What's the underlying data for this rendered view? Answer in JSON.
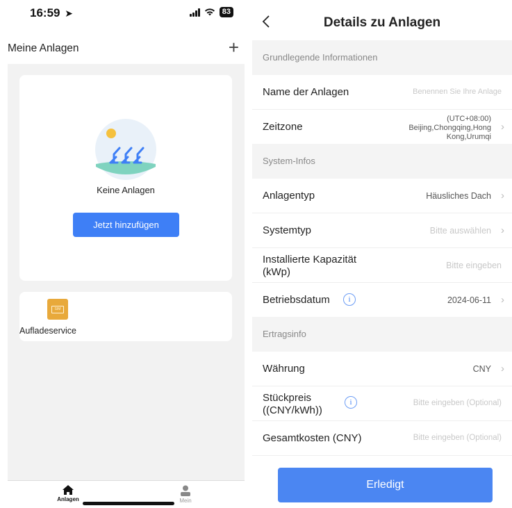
{
  "left_screen": {
    "status": {
      "time": "16:59",
      "battery": "83"
    },
    "header": {
      "title": "Meine Anlagen",
      "add_icon": "plus-icon"
    },
    "empty_state": {
      "text": "Keine Anlagen",
      "button": "Jetzt hinzufügen"
    },
    "service": {
      "label": "Aufladeservice",
      "icon": "sim-card-icon",
      "icon_text": "SIM"
    },
    "tabbar": {
      "tabs": [
        {
          "label": "Anlagen",
          "icon": "home-icon",
          "active": true
        },
        {
          "label": "Mein",
          "icon": "person-icon",
          "active": false
        }
      ]
    },
    "colors": {
      "primary": "#3e7ff6",
      "service_icon": "#e8a93b",
      "background": "#f2f2f2"
    }
  },
  "right_screen": {
    "nav": {
      "back_icon": "chevron-left-icon",
      "title": "Details zu Anlagen"
    },
    "sections": [
      {
        "title": "Grundlegende Informationen",
        "rows": [
          {
            "label": "Name der Anlagen",
            "value": "Benennen Sie Ihre Anlage",
            "placeholder": true,
            "chevron": false
          },
          {
            "label": "Zeitzone",
            "value": "(UTC+08:00) Beijing,Chongqing,Hong Kong,Urumqi",
            "placeholder": false,
            "chevron": true
          }
        ]
      },
      {
        "title": "System-Infos",
        "rows": [
          {
            "label": "Anlagentyp",
            "value": "Häusliches Dach",
            "placeholder": false,
            "chevron": true
          },
          {
            "label": "Systemtyp",
            "value": "Bitte auswählen",
            "placeholder": true,
            "chevron": true
          },
          {
            "label": "Installierte Kapazität (kWp)",
            "value": "Bitte eingeben",
            "placeholder": true,
            "chevron": false
          },
          {
            "label": "Betriebsdatum",
            "value": "2024-06-11",
            "placeholder": false,
            "chevron": true,
            "info": true
          }
        ]
      },
      {
        "title": "Ertragsinfo",
        "rows": [
          {
            "label": "Währung",
            "value": "CNY",
            "placeholder": false,
            "chevron": true
          },
          {
            "label": "Stückpreis ((CNY/kWh))",
            "value": "Bitte eingeben (Optional)",
            "placeholder": true,
            "chevron": false,
            "info": true
          },
          {
            "label": "Gesamtkosten (CNY)",
            "value": "Bitte eingeben (Optional)",
            "placeholder": true,
            "chevron": false
          }
        ]
      }
    ],
    "timezone_lines": [
      "(UTC+08:00)",
      "Beijing,Chongqing,Hong",
      "Kong,Urumqi"
    ],
    "capacity_lines": [
      "Installierte Kapazität",
      "(kWp)"
    ],
    "price_lines": [
      "Stückpreis",
      "((CNY/kWh))"
    ],
    "done_button": "Erledigt",
    "colors": {
      "button": "#4b86f2",
      "section_bg": "#f4f4f4",
      "placeholder": "#c8c8c8"
    }
  }
}
